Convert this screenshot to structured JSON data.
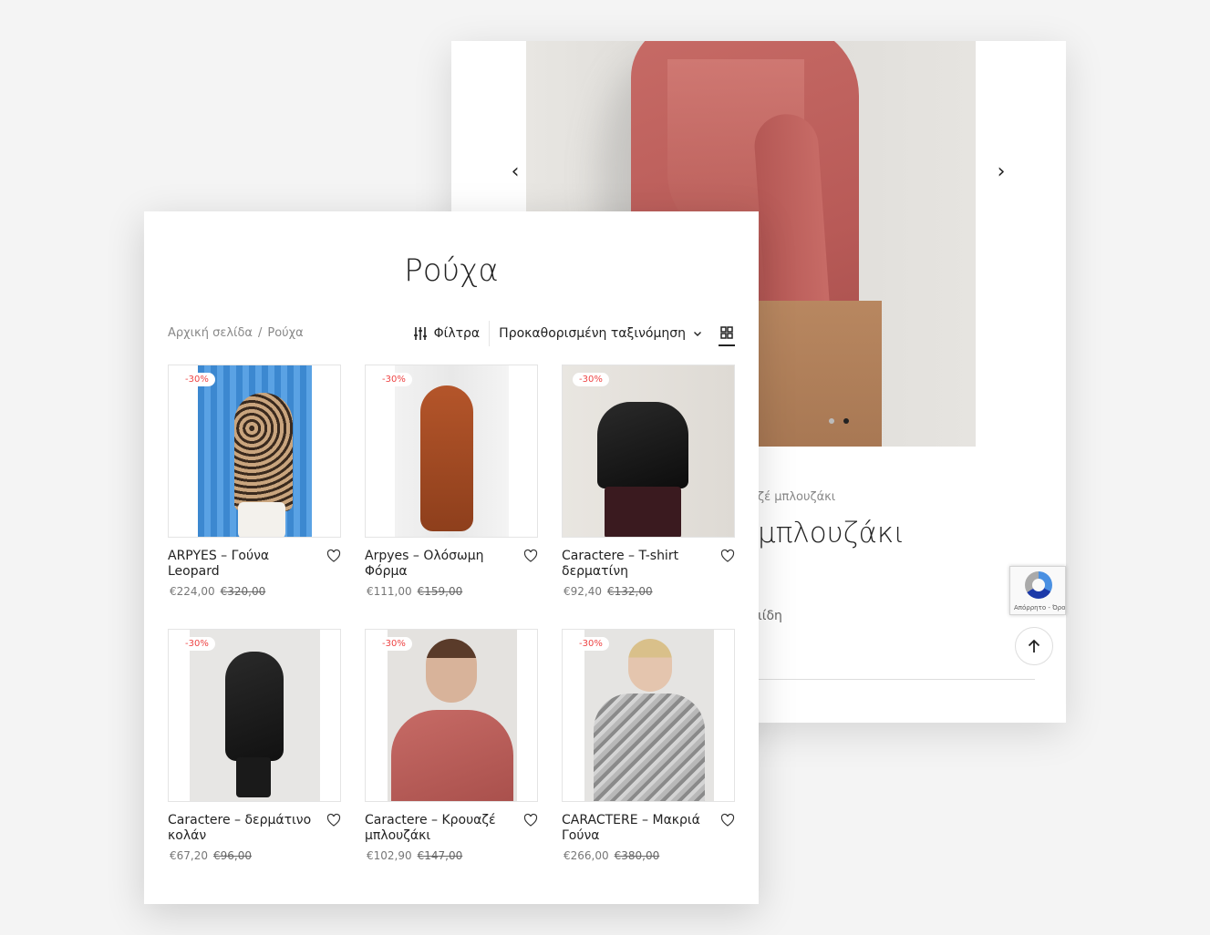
{
  "product_page": {
    "breadcrumb_partial": "ζέ μπλουζάκι",
    "title_partial": "μπλουζάκι",
    "meta_partial": "ιίδη",
    "recaptcha_text": "Απόρρητο - Όροι",
    "prev_icon": "chevron-left-icon",
    "next_icon": "chevron-right-icon",
    "slider_dots": 3,
    "active_dot": 2
  },
  "category_page": {
    "title": "Ρούχα",
    "breadcrumb": [
      "Αρχική σελίδα",
      "Ρούχα"
    ],
    "breadcrumb_separator": "/",
    "toolbar": {
      "filter_label": "Φίλτρα",
      "sort_label": "Προκαθορισμένη ταξινόμηση"
    },
    "products": [
      {
        "name": "ARPYES – Γούνα Leopard",
        "price": "€224,00",
        "old_price": "€320,00",
        "badge": "-30%"
      },
      {
        "name": "Arpyes – Ολόσωμη Φόρμα",
        "price": "€111,00",
        "old_price": "€159,00",
        "badge": "-30%"
      },
      {
        "name": "Caractere – T-shirt δερματίνη",
        "price": "€92,40",
        "old_price": "€132,00",
        "badge": "-30%"
      },
      {
        "name": "Caractere – δερμάτινο κολάν",
        "price": "€67,20",
        "old_price": "€96,00",
        "badge": "-30%"
      },
      {
        "name": "Caractere – Κρουαζέ μπλουζάκι",
        "price": "€102,90",
        "old_price": "€147,00",
        "badge": "-30%"
      },
      {
        "name": "CARACTERE – Μακριά Γούνα",
        "price": "€266,00",
        "old_price": "€380,00",
        "badge": "-30%"
      }
    ]
  },
  "colors": {
    "background": "#f4f4f4",
    "badge_text": "#e44444",
    "text": "#222222",
    "muted": "#888888"
  }
}
